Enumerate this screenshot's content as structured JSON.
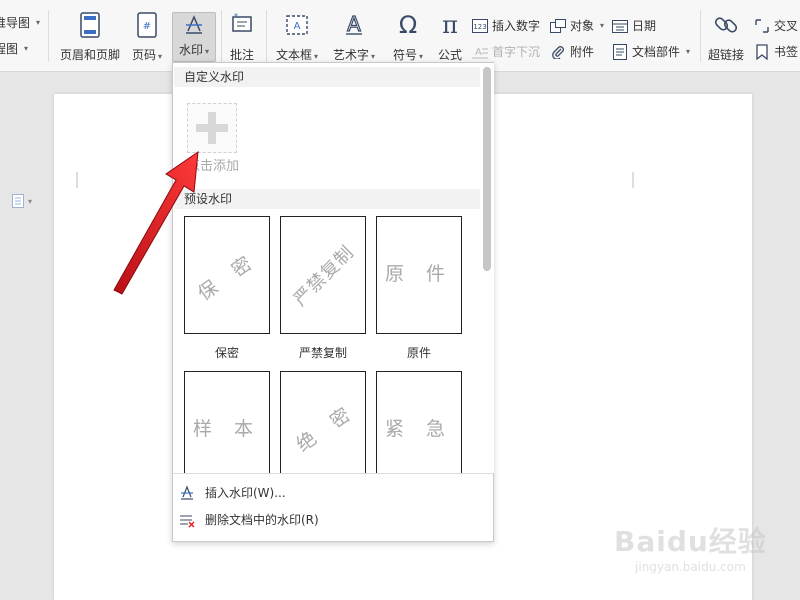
{
  "ribbon": {
    "left_items": [
      {
        "label": "推导图",
        "has_caret": true
      },
      {
        "label": "程图",
        "has_caret": true
      }
    ],
    "header_footer": {
      "label": "页眉和页脚",
      "icon": "header-footer-icon"
    },
    "page_number": {
      "label": "页码",
      "icon": "page-number-icon"
    },
    "watermark": {
      "label": "水印",
      "icon": "watermark-icon"
    },
    "comment": {
      "label": "批注",
      "icon": "comment-icon"
    },
    "textbox": {
      "label": "文本框",
      "icon": "textbox-icon"
    },
    "wordart": {
      "label": "艺术字",
      "icon": "wordart-icon"
    },
    "symbol": {
      "label": "符号",
      "icon": "omega-icon"
    },
    "formula": {
      "label": "公式",
      "icon": "pi-icon"
    },
    "insert_number": {
      "label": "插入数字"
    },
    "object": {
      "label": "对象"
    },
    "date": {
      "label": "日期"
    },
    "dropcap": {
      "label": "首字下沉"
    },
    "attachment": {
      "label": "附件"
    },
    "doc_parts": {
      "label": "文档部件"
    },
    "hyperlink": {
      "label": "超链接"
    },
    "cross_ref": {
      "label": "交叉"
    },
    "bookmark": {
      "label": "书签"
    }
  },
  "watermark_panel": {
    "custom_header": "自定义水印",
    "add_label": "点击添加",
    "preset_header": "预设水印",
    "presets": [
      {
        "text": "保 密",
        "label": "保密",
        "rotated": true
      },
      {
        "text": "严禁复制",
        "label": "严禁复制",
        "rotated": true
      },
      {
        "text": "原 件",
        "label": "原件",
        "rotated": false
      },
      {
        "text": "样 本",
        "label": "",
        "rotated": false
      },
      {
        "text": "绝 密",
        "label": "",
        "rotated": true
      },
      {
        "text": "紧 急",
        "label": "",
        "rotated": false
      }
    ],
    "footer": [
      {
        "label": "插入水印(W)...",
        "icon": "watermark-icon"
      },
      {
        "label": "删除文档中的水印(R)",
        "icon": "delete-watermark-icon"
      }
    ]
  },
  "brand_watermark": {
    "logo": "Baidu经验",
    "url": "jingyan.baidu.com"
  },
  "colors": {
    "arrow": "#e8141e",
    "accent": "#3b6fc4"
  }
}
